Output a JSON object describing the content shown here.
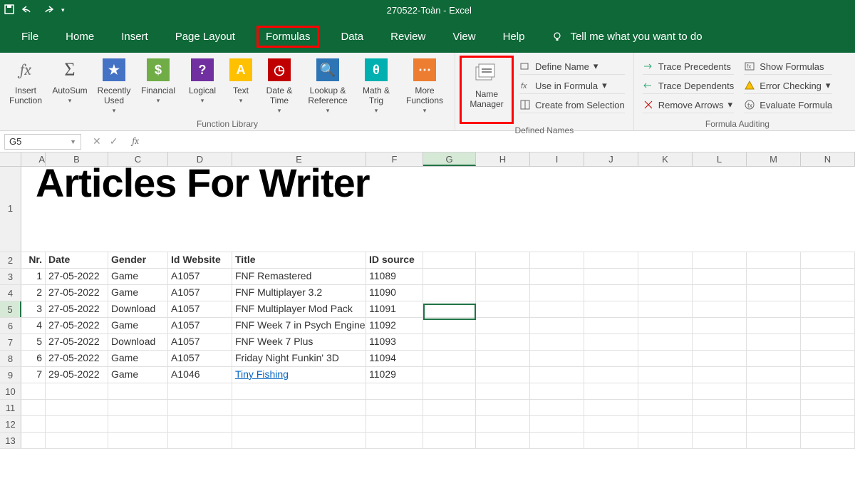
{
  "title": "270522-Toàn - Excel",
  "menubar": {
    "tabs": [
      "File",
      "Home",
      "Insert",
      "Page Layout",
      "Formulas",
      "Data",
      "Review",
      "View",
      "Help"
    ],
    "active": "Formulas",
    "tellme": "Tell me what you want to do"
  },
  "ribbon": {
    "func_lib": {
      "label": "Function Library",
      "insert_function": "Insert Function",
      "autosum": "AutoSum",
      "recently": "Recently Used",
      "financial": "Financial",
      "logical": "Logical",
      "text": "Text",
      "date": "Date & Time",
      "lookup": "Lookup & Reference",
      "math": "Math & Trig",
      "more": "More Functions"
    },
    "defined_names": {
      "label": "Defined Names",
      "name_manager": "Name Manager",
      "define_name": "Define Name",
      "use_in_formula": "Use in Formula",
      "create_from_selection": "Create from Selection"
    },
    "auditing": {
      "label": "Formula Auditing",
      "trace_precedents": "Trace Precedents",
      "trace_dependents": "Trace Dependents",
      "remove_arrows": "Remove Arrows",
      "show_formulas": "Show Formulas",
      "error_checking": "Error Checking",
      "evaluate_formula": "Evaluate Formula"
    }
  },
  "formulabar": {
    "namebox": "G5",
    "formula": ""
  },
  "columns": [
    "A",
    "B",
    "C",
    "D",
    "E",
    "F",
    "G",
    "H",
    "I",
    "J",
    "K",
    "L",
    "M",
    "N"
  ],
  "worksheet": {
    "title_cell": "Articles For Writer",
    "headers": {
      "nr": "Nr.",
      "date": "Date",
      "gender": "Gender",
      "idw": "Id Website",
      "title": "Title",
      "src": "ID source"
    },
    "rows": [
      {
        "nr": "1",
        "date": "27-05-2022",
        "gender": "Game",
        "idw": "A1057",
        "title": "FNF Remastered",
        "src": "11089",
        "link": false
      },
      {
        "nr": "2",
        "date": "27-05-2022",
        "gender": "Game",
        "idw": "A1057",
        "title": "FNF Multiplayer 3.2",
        "src": "11090",
        "link": false
      },
      {
        "nr": "3",
        "date": "27-05-2022",
        "gender": "Download",
        "idw": "A1057",
        "title": "FNF Multiplayer Mod Pack",
        "src": "11091",
        "link": false
      },
      {
        "nr": "4",
        "date": "27-05-2022",
        "gender": "Game",
        "idw": "A1057",
        "title": "FNF Week 7 in Psych Engine",
        "src": "11092",
        "link": false
      },
      {
        "nr": "5",
        "date": "27-05-2022",
        "gender": "Download",
        "idw": "A1057",
        "title": "FNF Week 7 Plus",
        "src": "11093",
        "link": false
      },
      {
        "nr": "6",
        "date": "27-05-2022",
        "gender": "Game",
        "idw": "A1057",
        "title": "Friday Night Funkin' 3D",
        "src": "11094",
        "link": false
      },
      {
        "nr": "7",
        "date": "29-05-2022",
        "gender": "Game",
        "idw": "A1046",
        "title": "Tiny Fishing",
        "src": "11029",
        "link": true
      }
    ]
  },
  "selected_cell": "G5"
}
